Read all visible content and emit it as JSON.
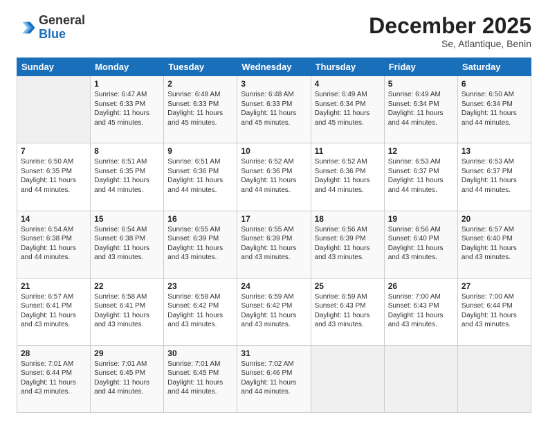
{
  "logo": {
    "general": "General",
    "blue": "Blue"
  },
  "header": {
    "month": "December 2025",
    "location": "Se, Atlantique, Benin"
  },
  "days_of_week": [
    "Sunday",
    "Monday",
    "Tuesday",
    "Wednesday",
    "Thursday",
    "Friday",
    "Saturday"
  ],
  "weeks": [
    [
      {
        "day": "",
        "info": ""
      },
      {
        "day": "1",
        "info": "Sunrise: 6:47 AM\nSunset: 6:33 PM\nDaylight: 11 hours\nand 45 minutes."
      },
      {
        "day": "2",
        "info": "Sunrise: 6:48 AM\nSunset: 6:33 PM\nDaylight: 11 hours\nand 45 minutes."
      },
      {
        "day": "3",
        "info": "Sunrise: 6:48 AM\nSunset: 6:33 PM\nDaylight: 11 hours\nand 45 minutes."
      },
      {
        "day": "4",
        "info": "Sunrise: 6:49 AM\nSunset: 6:34 PM\nDaylight: 11 hours\nand 45 minutes."
      },
      {
        "day": "5",
        "info": "Sunrise: 6:49 AM\nSunset: 6:34 PM\nDaylight: 11 hours\nand 44 minutes."
      },
      {
        "day": "6",
        "info": "Sunrise: 6:50 AM\nSunset: 6:34 PM\nDaylight: 11 hours\nand 44 minutes."
      }
    ],
    [
      {
        "day": "7",
        "info": "Sunrise: 6:50 AM\nSunset: 6:35 PM\nDaylight: 11 hours\nand 44 minutes."
      },
      {
        "day": "8",
        "info": "Sunrise: 6:51 AM\nSunset: 6:35 PM\nDaylight: 11 hours\nand 44 minutes."
      },
      {
        "day": "9",
        "info": "Sunrise: 6:51 AM\nSunset: 6:36 PM\nDaylight: 11 hours\nand 44 minutes."
      },
      {
        "day": "10",
        "info": "Sunrise: 6:52 AM\nSunset: 6:36 PM\nDaylight: 11 hours\nand 44 minutes."
      },
      {
        "day": "11",
        "info": "Sunrise: 6:52 AM\nSunset: 6:36 PM\nDaylight: 11 hours\nand 44 minutes."
      },
      {
        "day": "12",
        "info": "Sunrise: 6:53 AM\nSunset: 6:37 PM\nDaylight: 11 hours\nand 44 minutes."
      },
      {
        "day": "13",
        "info": "Sunrise: 6:53 AM\nSunset: 6:37 PM\nDaylight: 11 hours\nand 44 minutes."
      }
    ],
    [
      {
        "day": "14",
        "info": "Sunrise: 6:54 AM\nSunset: 6:38 PM\nDaylight: 11 hours\nand 44 minutes."
      },
      {
        "day": "15",
        "info": "Sunrise: 6:54 AM\nSunset: 6:38 PM\nDaylight: 11 hours\nand 43 minutes."
      },
      {
        "day": "16",
        "info": "Sunrise: 6:55 AM\nSunset: 6:39 PM\nDaylight: 11 hours\nand 43 minutes."
      },
      {
        "day": "17",
        "info": "Sunrise: 6:55 AM\nSunset: 6:39 PM\nDaylight: 11 hours\nand 43 minutes."
      },
      {
        "day": "18",
        "info": "Sunrise: 6:56 AM\nSunset: 6:39 PM\nDaylight: 11 hours\nand 43 minutes."
      },
      {
        "day": "19",
        "info": "Sunrise: 6:56 AM\nSunset: 6:40 PM\nDaylight: 11 hours\nand 43 minutes."
      },
      {
        "day": "20",
        "info": "Sunrise: 6:57 AM\nSunset: 6:40 PM\nDaylight: 11 hours\nand 43 minutes."
      }
    ],
    [
      {
        "day": "21",
        "info": "Sunrise: 6:57 AM\nSunset: 6:41 PM\nDaylight: 11 hours\nand 43 minutes."
      },
      {
        "day": "22",
        "info": "Sunrise: 6:58 AM\nSunset: 6:41 PM\nDaylight: 11 hours\nand 43 minutes."
      },
      {
        "day": "23",
        "info": "Sunrise: 6:58 AM\nSunset: 6:42 PM\nDaylight: 11 hours\nand 43 minutes."
      },
      {
        "day": "24",
        "info": "Sunrise: 6:59 AM\nSunset: 6:42 PM\nDaylight: 11 hours\nand 43 minutes."
      },
      {
        "day": "25",
        "info": "Sunrise: 6:59 AM\nSunset: 6:43 PM\nDaylight: 11 hours\nand 43 minutes."
      },
      {
        "day": "26",
        "info": "Sunrise: 7:00 AM\nSunset: 6:43 PM\nDaylight: 11 hours\nand 43 minutes."
      },
      {
        "day": "27",
        "info": "Sunrise: 7:00 AM\nSunset: 6:44 PM\nDaylight: 11 hours\nand 43 minutes."
      }
    ],
    [
      {
        "day": "28",
        "info": "Sunrise: 7:01 AM\nSunset: 6:44 PM\nDaylight: 11 hours\nand 43 minutes."
      },
      {
        "day": "29",
        "info": "Sunrise: 7:01 AM\nSunset: 6:45 PM\nDaylight: 11 hours\nand 44 minutes."
      },
      {
        "day": "30",
        "info": "Sunrise: 7:01 AM\nSunset: 6:45 PM\nDaylight: 11 hours\nand 44 minutes."
      },
      {
        "day": "31",
        "info": "Sunrise: 7:02 AM\nSunset: 6:46 PM\nDaylight: 11 hours\nand 44 minutes."
      },
      {
        "day": "",
        "info": ""
      },
      {
        "day": "",
        "info": ""
      },
      {
        "day": "",
        "info": ""
      }
    ]
  ]
}
